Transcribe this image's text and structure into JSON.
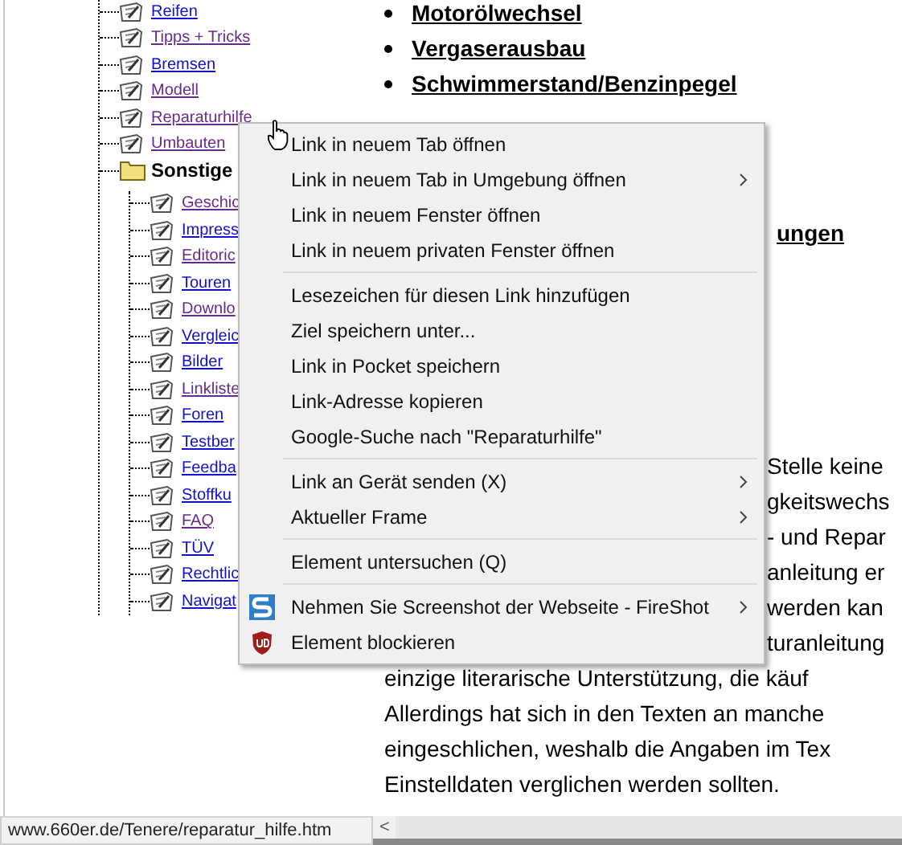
{
  "tree": [
    {
      "kind": "page",
      "label": "Reifen",
      "visited": false
    },
    {
      "kind": "page",
      "label": "Tipps + Tricks",
      "visited": true
    },
    {
      "kind": "page",
      "label": "Bremsen",
      "visited": false
    },
    {
      "kind": "page",
      "label": "Modell",
      "visited": true
    },
    {
      "kind": "page",
      "label": "Reparaturhilfe",
      "visited": true
    },
    {
      "kind": "page",
      "label": "Umbauten",
      "visited": true
    },
    {
      "kind": "folder",
      "label": "Sonstige",
      "children": [
        {
          "kind": "page",
          "label": "Geschic",
          "visited": true
        },
        {
          "kind": "page",
          "label": "Impress",
          "visited": false
        },
        {
          "kind": "page",
          "label": "Editoric",
          "visited": true
        },
        {
          "kind": "page",
          "label": "Touren",
          "visited": false
        },
        {
          "kind": "page",
          "label": "Downlo",
          "visited": true
        },
        {
          "kind": "page",
          "label": "Vergleic",
          "visited": false
        },
        {
          "kind": "page",
          "label": "Bilder",
          "visited": false
        },
        {
          "kind": "page",
          "label": "Linkliste",
          "visited": true
        },
        {
          "kind": "page",
          "label": "Foren",
          "visited": false
        },
        {
          "kind": "page",
          "label": "Testber",
          "visited": false
        },
        {
          "kind": "page",
          "label": "Feedba",
          "visited": false
        },
        {
          "kind": "page",
          "label": "Stoffku",
          "visited": false
        },
        {
          "kind": "page",
          "label": "FAQ",
          "visited": true
        },
        {
          "kind": "page",
          "label": "TÜV",
          "visited": false
        },
        {
          "kind": "page",
          "label": "Rechtlic",
          "visited": false
        },
        {
          "kind": "page",
          "label": "Navigat",
          "visited": false
        }
      ]
    }
  ],
  "article": {
    "headings": [
      "Motorölwechsel",
      "Vergaserausbau",
      "Schwimmerstand/Benzinpegel"
    ],
    "heading_fragment": "ungen",
    "paragraph_fragments": [
      "Stelle keine",
      "gkeitswechs",
      "- und Repar",
      "anleitung er",
      "werden kan",
      "turanleitung"
    ],
    "paragraph_lines": [
      "einzige literarische Unterstützung, die käuf",
      "Allerdings hat sich in den Texten an manche",
      "eingeschlichen, weshalb die Angaben im Tex",
      "Einstelldaten verglichen werden sollten."
    ]
  },
  "context_menu": [
    [
      {
        "kind": "plain",
        "label": "Link in neuem Tab öffnen",
        "submenu": false
      },
      {
        "kind": "plain",
        "label": "Link in neuem Tab in Umgebung öffnen",
        "submenu": true
      },
      {
        "kind": "plain",
        "label": "Link in neuem Fenster öffnen",
        "submenu": false
      },
      {
        "kind": "plain",
        "label": "Link in neuem privaten Fenster öffnen",
        "submenu": false
      }
    ],
    [
      {
        "kind": "plain",
        "label": "Lesezeichen für diesen Link hinzufügen",
        "submenu": false
      },
      {
        "kind": "plain",
        "label": "Ziel speichern unter...",
        "submenu": false
      },
      {
        "kind": "plain",
        "label": "Link in Pocket speichern",
        "submenu": false
      },
      {
        "kind": "plain",
        "label": "Link-Adresse kopieren",
        "submenu": false
      },
      {
        "kind": "plain",
        "label": "Google-Suche nach \"Reparaturhilfe\"",
        "submenu": false
      }
    ],
    [
      {
        "kind": "plain",
        "label": "Link an Gerät senden (X)",
        "submenu": true
      },
      {
        "kind": "plain",
        "label": "Aktueller Frame",
        "submenu": true
      }
    ],
    [
      {
        "kind": "plain",
        "label": "Element untersuchen (Q)",
        "submenu": false
      }
    ],
    [
      {
        "kind": "fireshot",
        "label": "Nehmen Sie Screenshot der Webseite - FireShot",
        "submenu": true
      },
      {
        "kind": "blocker",
        "label": "Element blockieren",
        "submenu": false
      }
    ]
  ],
  "status_bar": {
    "url": "www.660er.de/Tenere/reparatur_hilfe.htm",
    "scroll_arrow": "<"
  }
}
